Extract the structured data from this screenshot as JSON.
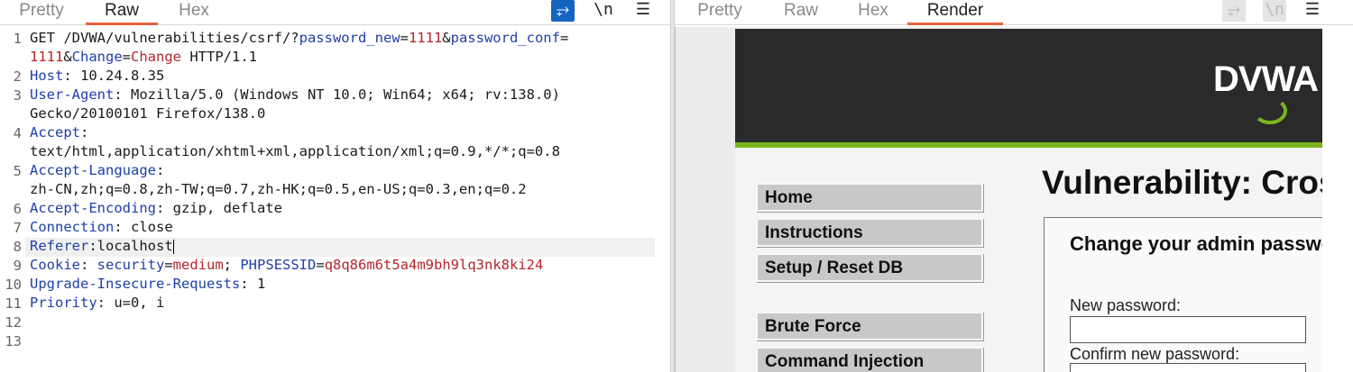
{
  "request": {
    "tabs": [
      "Pretty",
      "Raw",
      "Hex"
    ],
    "active_tab": "Raw",
    "toolbar": {
      "newline_label": "\\n",
      "menu_label": "☰",
      "wrap_label": "⥅"
    }
  },
  "code": {
    "line_numbers": [
      "1",
      "",
      "2",
      "3",
      "",
      "4",
      "",
      "5",
      "",
      "6",
      "7",
      "8",
      "9",
      "10",
      "11",
      "12",
      "13"
    ],
    "l1_method": "GET /DVWA/vulnerabilities/csrf/?",
    "l1_pnew_k": "password_new",
    "l1_eq1": "=",
    "l1_pnew_v": "1111",
    "l1_amp1": "&",
    "l1_pconf_k": "password_conf",
    "l1_eq2": "=",
    "l1b_pconf_v": "1111",
    "l1b_amp2": "&",
    "l1b_change_k": "Change",
    "l1b_eq3": "=",
    "l1b_change_v": "Change",
    "l1b_proto": " HTTP/1.1",
    "host_k": "Host",
    "host_v": ": 10.24.8.35",
    "ua_k": "User-Agent",
    "ua_v": ": Mozilla/5.0 (Windows NT 10.0; Win64; x64; rv:138.0)",
    "ua_v2": "Gecko/20100101 Firefox/138.0",
    "accept_k": "Accept",
    "accept_colon": ":",
    "accept_v": "text/html,application/xhtml+xml,application/xml;q=0.9,*/*;q=0.8",
    "al_k": "Accept-Language",
    "al_colon": ":",
    "al_v": "zh-CN,zh;q=0.8,zh-TW;q=0.7,zh-HK;q=0.5,en-US;q=0.3,en;q=0.2",
    "ae_k": "Accept-Encoding",
    "ae_v": ": gzip, deflate",
    "conn_k": "Connection",
    "conn_v": ": close",
    "ref_k": "Referer",
    "ref_v": ":localhost",
    "cookie_k": "Cookie",
    "cookie_sep": ": ",
    "sec_k": "security",
    "sec_eq": "=",
    "sec_v": "medium",
    "semi": "; ",
    "sess_k": "PHPSESSID",
    "sess_eq": "=",
    "sess_v": "q8q86m6t5a4m9bh9lq3nk8ki24",
    "uir_k": "Upgrade-Insecure-Requests",
    "uir_v": ": 1",
    "prio_k": "Priority",
    "prio_v": ": u=0, i"
  },
  "response": {
    "tabs": [
      "Pretty",
      "Raw",
      "Hex",
      "Render"
    ],
    "active_tab": "Render",
    "toolbar": {
      "newline_label": "\\n",
      "menu_label": "☰",
      "wrap_label": "⥅"
    }
  },
  "render": {
    "logo_text": "DVWA",
    "menu": [
      "Home",
      "Instructions",
      "Setup / Reset DB",
      "Brute Force",
      "Command Injection"
    ],
    "title": "Vulnerability: Cross Site Request Forgery (CSRF)",
    "subtitle": "Change your admin password:",
    "new_password_label": "New password:",
    "confirm_password_label": "Confirm new password:"
  },
  "colors": {
    "accent_tab": "#e8613c",
    "key_blue": "#1f3fa8",
    "value_red": "#b3262b",
    "dvwa_green": "#7ab51d"
  }
}
